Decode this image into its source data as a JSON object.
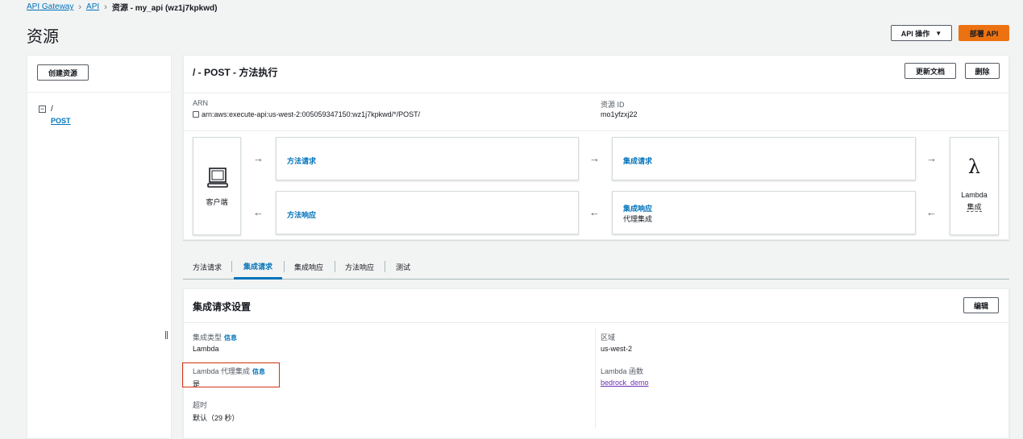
{
  "breadcrumb": {
    "items": [
      "API Gateway",
      "API"
    ],
    "current": "资源 - my_api (wz1j7kpkwd)"
  },
  "page": {
    "title": "资源"
  },
  "header_buttons": {
    "api_actions": "API 操作",
    "deploy": "部署 API"
  },
  "left": {
    "create_resource": "创建资源",
    "tree_root": "/",
    "tree_method": "POST"
  },
  "method": {
    "title": "/ - POST - 方法执行",
    "update_docs": "更新文档",
    "delete": "删除",
    "arn_label": "ARN",
    "arn_value": "arn:aws:execute-api:us-west-2:005059347150:wz1j7kpkwd/*/POST/",
    "resource_id_label": "资源 ID",
    "resource_id_value": "mo1yfzxj22",
    "client_label": "客户端",
    "method_request": "方法请求",
    "method_response": "方法响应",
    "integration_request": "集成请求",
    "integration_response": "集成响应",
    "proxy_integration": "代理集成",
    "lambda_label": "Lambda",
    "lambda_integration": "集成",
    "arrow_right": "→",
    "arrow_left": "←"
  },
  "tabs": [
    "方法请求",
    "集成请求",
    "集成响应",
    "方法响应",
    "测试"
  ],
  "active_tab": "集成请求",
  "settings": {
    "title": "集成请求设置",
    "edit": "编辑",
    "integration_type_label": "集成类型",
    "info": "信息",
    "integration_type_value": "Lambda",
    "lambda_proxy_label": "Lambda 代理集成",
    "lambda_proxy_value": "是",
    "timeout_label": "超时",
    "timeout_value": "默认（29 秒）",
    "region_label": "区域",
    "region_value": "us-west-2",
    "lambda_function_label": "Lambda 函数",
    "lambda_function_value": "bedrock_demo"
  },
  "colors": {
    "accent": "#0073bb",
    "primary_button": "#ec7211",
    "highlight": "#d13212"
  }
}
